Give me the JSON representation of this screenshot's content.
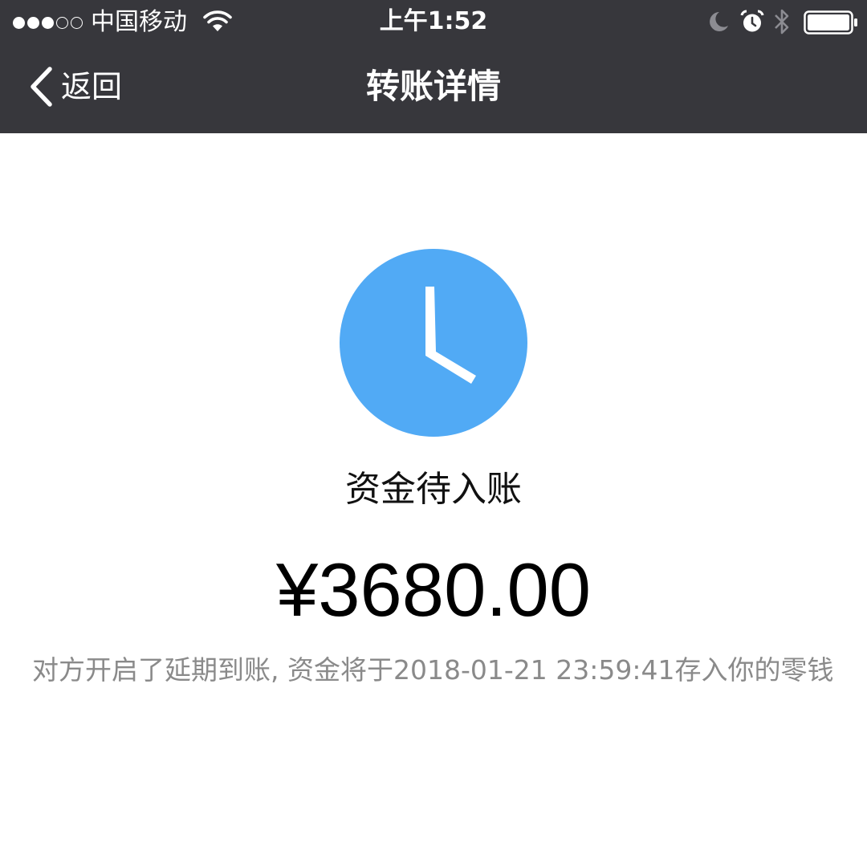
{
  "status_bar": {
    "carrier": "中国移动",
    "time": "上午1:52",
    "signal_icon": "signal-dots-icon",
    "wifi_icon": "wifi-icon",
    "moon_icon": "do-not-disturb-moon-icon",
    "alarm_icon": "alarm-clock-icon",
    "bluetooth_icon": "bluetooth-icon",
    "battery_icon": "battery-icon"
  },
  "nav": {
    "back_label": "返回",
    "title": "转账详情",
    "back_icon": "chevron-left-icon"
  },
  "transfer": {
    "status_icon": "clock-icon",
    "status_text": "资金待入账",
    "amount": "¥3680.00",
    "note": "对方开启了延期到账, 资金将于2018-01-21 23:59:41存入你的零钱"
  },
  "colors": {
    "topbar_bg": "#37373c",
    "accent_blue": "#51aaf5",
    "note_gray": "#8a8a8a"
  }
}
